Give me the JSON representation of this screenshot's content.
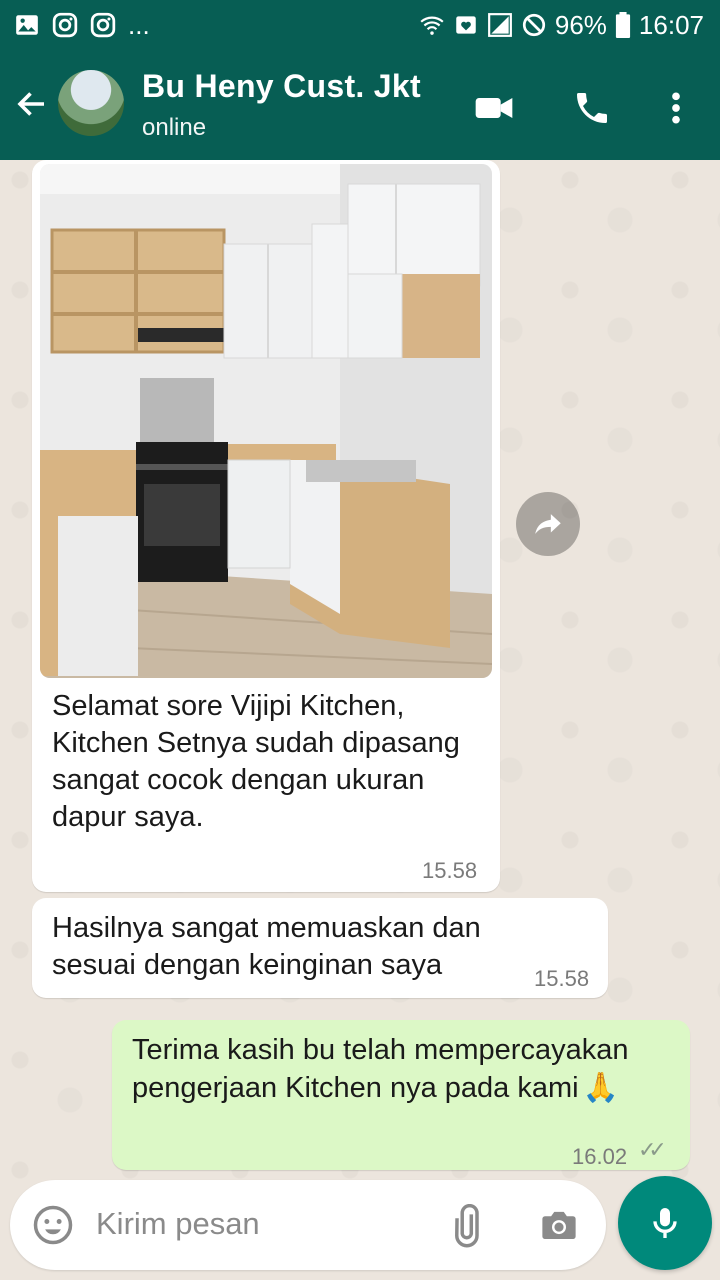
{
  "status_bar": {
    "battery": "96%",
    "time": "16:07",
    "overflow": "..."
  },
  "header": {
    "contact_name": "Bu Heny Cust. Jkt",
    "contact_status": "online"
  },
  "messages": [
    {
      "type": "incoming-image",
      "caption": "Selamat sore Vijipi Kitchen, Kitchen Setnya sudah dipasang sangat cocok dengan ukuran dapur saya.",
      "time": "15.58"
    },
    {
      "type": "incoming",
      "text": "Hasilnya sangat memuaskan dan sesuai dengan keinginan saya",
      "time": "15.58"
    },
    {
      "type": "outgoing",
      "text": "Terima kasih bu telah mempercayakan pengerjaan Kitchen nya pada kami",
      "emoji": "🙏",
      "time": "16.02",
      "ticks": "✓✓"
    }
  ],
  "composer": {
    "placeholder": "Kirim pesan"
  },
  "colors": {
    "header": "#075e54",
    "chat_bg": "#ece5dd",
    "outgoing_bubble": "#dcf8c6",
    "mic_button": "#00897b"
  },
  "icons": [
    "gallery-icon",
    "instagram-icon",
    "wifi-icon",
    "signal-icon",
    "dnd-icon",
    "battery-icon",
    "back-arrow-icon",
    "video-call-icon",
    "phone-icon",
    "more-options-icon",
    "forward-icon",
    "emoji-icon",
    "attach-icon",
    "camera-icon",
    "mic-icon"
  ]
}
